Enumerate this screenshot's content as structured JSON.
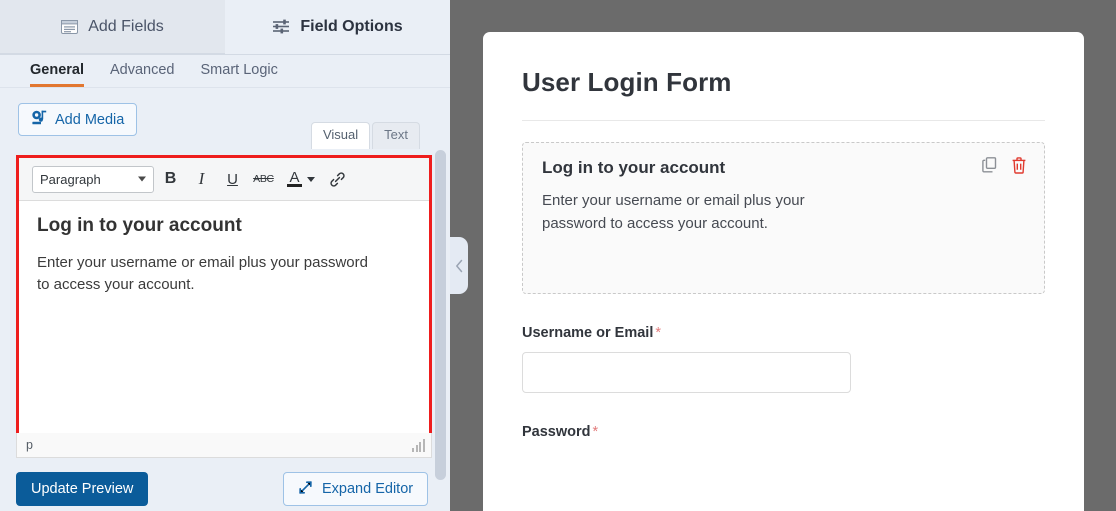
{
  "left_panel": {
    "tabs": [
      {
        "label": "Add Fields",
        "icon": "form-fields-icon",
        "active": false
      },
      {
        "label": "Field Options",
        "icon": "sliders-icon",
        "active": true
      }
    ],
    "subtabs": [
      {
        "label": "General",
        "active": true
      },
      {
        "label": "Advanced",
        "active": false
      },
      {
        "label": "Smart Logic",
        "active": false
      }
    ],
    "add_media_label": "Add Media",
    "editor_mode_tabs": [
      {
        "label": "Visual",
        "active": true
      },
      {
        "label": "Text",
        "active": false
      }
    ],
    "toolbar": {
      "format_select_value": "Paragraph",
      "buttons": [
        {
          "name": "bold",
          "glyph": "B"
        },
        {
          "name": "italic",
          "glyph": "I"
        },
        {
          "name": "underline",
          "glyph": "U"
        },
        {
          "name": "strikethrough",
          "glyph": "ABC"
        },
        {
          "name": "text-color",
          "glyph": "A"
        },
        {
          "name": "insert-link",
          "glyph": "link"
        }
      ]
    },
    "editor": {
      "heading": "Log in to your account",
      "paragraph": "Enter your username or email plus your password to access your account."
    },
    "statusbar_path": "p",
    "update_preview_label": "Update Preview",
    "expand_editor_label": "Expand Editor",
    "highlight_color": "#ee1d1d",
    "accent_color": "#e27730"
  },
  "preview": {
    "form_title": "User Login Form",
    "html_block": {
      "heading": "Log in to your account",
      "paragraph": "Enter your username or email plus your password to access your account.",
      "actions": [
        {
          "name": "duplicate-block",
          "icon": "copy-icon",
          "color": "#8c9096"
        },
        {
          "name": "delete-block",
          "icon": "trash-icon",
          "color": "#e03a2f"
        }
      ]
    },
    "fields": [
      {
        "label": "Username or Email",
        "required_marker": "*",
        "value": ""
      },
      {
        "label": "Password",
        "required_marker": "*",
        "value": ""
      }
    ]
  }
}
